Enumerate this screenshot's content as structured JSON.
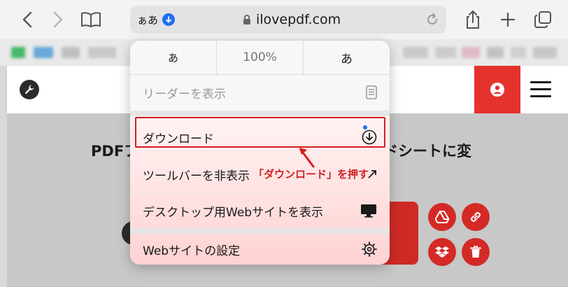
{
  "toolbar": {
    "text_size_label": "ぁあ",
    "domain": "ilovepdf.com",
    "icons": [
      "back-icon",
      "forward-icon",
      "bookmarks-book-icon",
      "download-indicator-icon",
      "lock-icon",
      "reload-icon",
      "share-icon",
      "new-tab-plus-icon",
      "tabs-icon"
    ]
  },
  "page": {
    "hero_left": "PDFフ",
    "hero_right": "ドシートに変"
  },
  "popup": {
    "zoom_small": "あ",
    "zoom_percent": "100%",
    "zoom_large": "あ",
    "reader": "リーダーを表示",
    "download": "ダウンロード",
    "hide_toolbar": "ツールバーを非表示",
    "desktop_site": "デスクトップ用Webサイトを表示",
    "site_settings": "Webサイトの設定"
  },
  "annotation": {
    "text": "「ダウンロード」を押す"
  },
  "colors": {
    "accent_red": "#e5322d",
    "safari_blue": "#1e6ff0",
    "annotation_red": "#d21f1f"
  }
}
